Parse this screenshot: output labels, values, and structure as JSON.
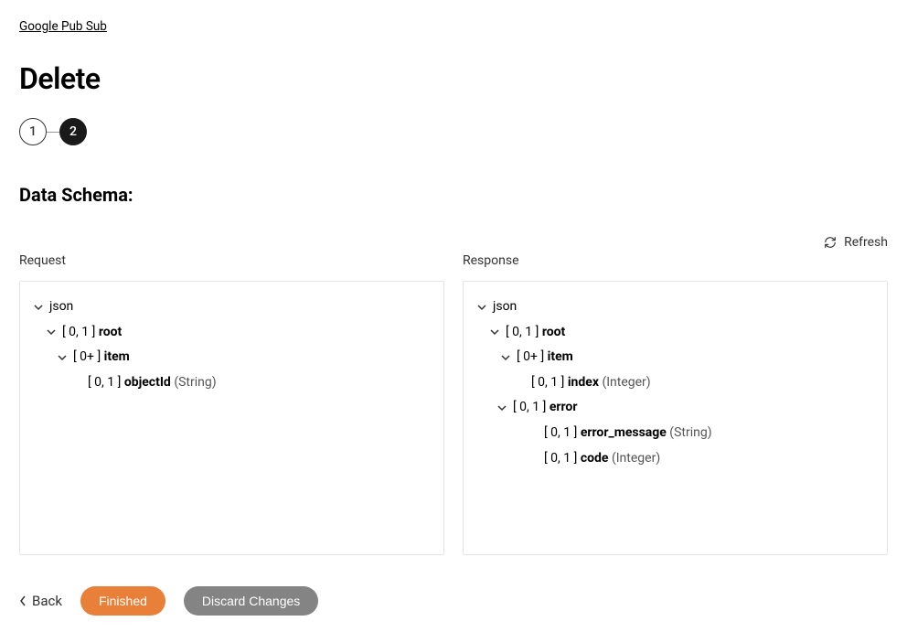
{
  "breadcrumb": "Google Pub Sub",
  "page_title": "Delete",
  "stepper": {
    "step1": "1",
    "step2": "2"
  },
  "section_header": "Data Schema:",
  "refresh_label": "Refresh",
  "columns": {
    "request": {
      "label": "Request",
      "tree": {
        "n0": {
          "name": "json"
        },
        "n1": {
          "card": "[ 0, 1 ]",
          "name": "root"
        },
        "n2": {
          "card": "[ 0+ ]",
          "name": "item"
        },
        "n3": {
          "card": "[ 0, 1 ]",
          "name": "objectId",
          "type": "(String)"
        }
      }
    },
    "response": {
      "label": "Response",
      "tree": {
        "n0": {
          "name": "json"
        },
        "n1": {
          "card": "[ 0, 1 ]",
          "name": "root"
        },
        "n2": {
          "card": "[ 0+ ]",
          "name": "item"
        },
        "n3": {
          "card": "[ 0, 1 ]",
          "name": "index",
          "type": "(Integer)"
        },
        "n4": {
          "card": "[ 0, 1 ]",
          "name": "error"
        },
        "n5": {
          "card": "[ 0, 1 ]",
          "name": "error_message",
          "type": "(String)"
        },
        "n6": {
          "card": "[ 0, 1 ]",
          "name": "code",
          "type": "(Integer)"
        }
      }
    }
  },
  "footer": {
    "back": "Back",
    "finished": "Finished",
    "discard": "Discard Changes"
  }
}
